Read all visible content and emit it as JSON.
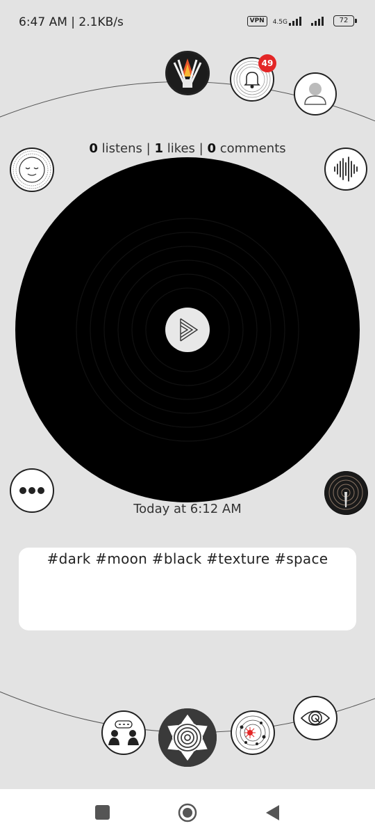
{
  "status_bar": {
    "time_speed": "6:47 AM | 2.1KB/s",
    "vpn_label": "VPN",
    "network_label": "4.5G",
    "battery": "72"
  },
  "header": {
    "notification_count": "49"
  },
  "stats": {
    "listens_count": "0",
    "listens_label": "listens |",
    "likes_count": "1",
    "likes_label": "likes |",
    "comments_count": "0",
    "comments_label": "comments"
  },
  "post": {
    "timestamp": "Today at 6:12 AM",
    "tags": "#dark #moon #black #texture #space"
  },
  "icons": {
    "avatar": "avatar-icon",
    "bell": "bell-icon",
    "profile": "profile-icon",
    "mood": "sleeping-face-icon",
    "waveform": "waveform-icon",
    "more": "more-dots-icon",
    "thumbnail": "track-thumbnail-icon",
    "people": "people-talking-icon",
    "shutter": "camera-shutter-icon",
    "map": "cosmic-map-icon",
    "eye": "eye-icon"
  },
  "colors": {
    "background": "#e3e3e3",
    "badge": "#e32626",
    "disc": "#000000"
  }
}
